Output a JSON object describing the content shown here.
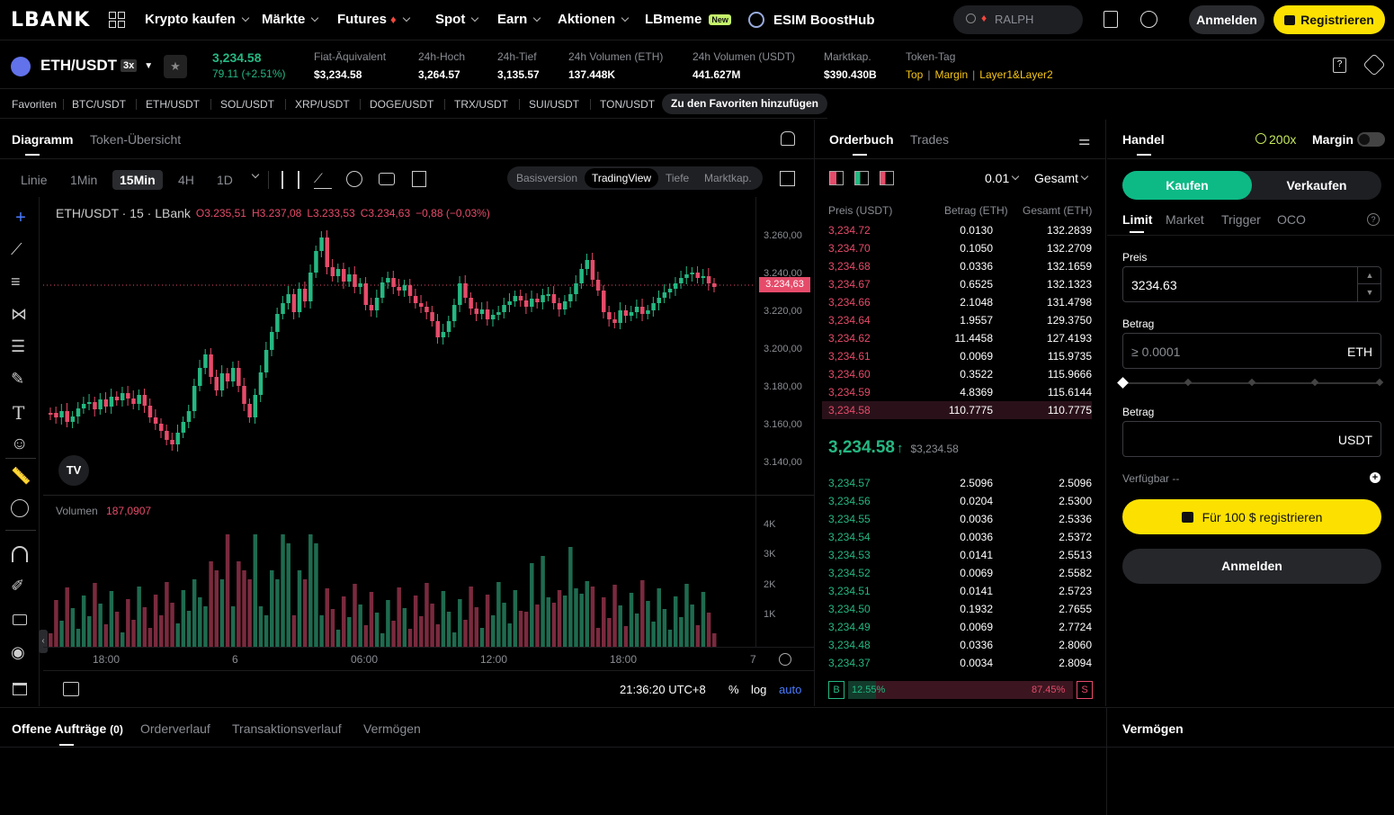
{
  "header": {
    "logo": "LBANK",
    "nav": [
      "Krypto kaufen",
      "Märkte",
      "Futures",
      "Spot",
      "Earn",
      "Aktionen",
      "LBmeme",
      "ESIM BoostHub"
    ],
    "new_badge": "New",
    "search_placeholder": "RALPH",
    "login": "Anmelden",
    "register": "Registrieren"
  },
  "ticker": {
    "pair": "ETH/USDT",
    "leverage": "3x",
    "price": "3,234.58",
    "change": "79.11 (+2.51%)",
    "stats": [
      {
        "label": "Fiat-Äquivalent",
        "value": "$3,234.58"
      },
      {
        "label": "24h-Hoch",
        "value": "3,264.57"
      },
      {
        "label": "24h-Tief",
        "value": "3,135.57"
      },
      {
        "label": "24h Volumen (ETH)",
        "value": "137.448K"
      },
      {
        "label": "24h Volumen (USDT)",
        "value": "441.627M"
      },
      {
        "label": "Marktkap.",
        "value": "$390.430B"
      }
    ],
    "tag_label": "Token-Tag",
    "tags": [
      "Top",
      "Margin",
      "Layer1&Layer2"
    ]
  },
  "favorites": {
    "label": "Favoriten",
    "pairs": [
      "BTC/USDT",
      "ETH/USDT",
      "SOL/USDT",
      "XRP/USDT",
      "DOGE/USDT",
      "TRX/USDT",
      "SUI/USDT",
      "TON/USDT"
    ],
    "add": "Zu den Favoriten hinzufügen"
  },
  "chart": {
    "tabs": [
      "Diagramm",
      "Token-Übersicht"
    ],
    "timeframes": [
      "Linie",
      "1Min",
      "15Min",
      "4H",
      "1D"
    ],
    "versions": [
      "Basisversion",
      "TradingView",
      "Tiefe",
      "Marktkap."
    ],
    "legend_pair": "ETH/USDT · 15 · LBank",
    "ohlc": {
      "o": "O3.235,51",
      "h": "H3.237,08",
      "l": "L3.233,53",
      "c": "C3.234,63",
      "chg": "−0,88 (−0,03%)"
    },
    "price_ticks": [
      "3.260,00",
      "3.240,00",
      "3.220,00",
      "3.200,00",
      "3.180,00",
      "3.160,00",
      "3.140,00"
    ],
    "last_price": "3.234,63",
    "volume_label": "Volumen",
    "volume_value": "187,0907",
    "volume_ticks": [
      "4K",
      "3K",
      "2K",
      "1K"
    ],
    "time_ticks": [
      "18:00",
      "6",
      "06:00",
      "12:00",
      "18:00",
      "7"
    ],
    "clock": "21:36:20 UTC+8",
    "pct": "%",
    "log": "log",
    "auto": "auto"
  },
  "orderbook": {
    "tabs": [
      "Orderbuch",
      "Trades"
    ],
    "precision": "0.01",
    "mode": "Gesamt",
    "headers": [
      "Preis (USDT)",
      "Betrag (ETH)",
      "Gesamt (ETH)"
    ],
    "asks": [
      [
        "3,234.72",
        "0.0130",
        "132.2839"
      ],
      [
        "3,234.70",
        "0.1050",
        "132.2709"
      ],
      [
        "3,234.68",
        "0.0336",
        "132.1659"
      ],
      [
        "3,234.67",
        "0.6525",
        "132.1323"
      ],
      [
        "3,234.66",
        "2.1048",
        "131.4798"
      ],
      [
        "3,234.64",
        "1.9557",
        "129.3750"
      ],
      [
        "3,234.62",
        "11.4458",
        "127.4193"
      ],
      [
        "3,234.61",
        "0.0069",
        "115.9735"
      ],
      [
        "3,234.60",
        "0.3522",
        "115.9666"
      ],
      [
        "3,234.59",
        "4.8369",
        "115.6144"
      ],
      [
        "3,234.58",
        "110.7775",
        "110.7775"
      ]
    ],
    "mid_price": "3,234.58",
    "mid_fiat": "$3,234.58",
    "bids": [
      [
        "3,234.57",
        "2.5096",
        "2.5096"
      ],
      [
        "3,234.56",
        "0.0204",
        "2.5300"
      ],
      [
        "3,234.55",
        "0.0036",
        "2.5336"
      ],
      [
        "3,234.54",
        "0.0036",
        "2.5372"
      ],
      [
        "3,234.53",
        "0.0141",
        "2.5513"
      ],
      [
        "3,234.52",
        "0.0069",
        "2.5582"
      ],
      [
        "3,234.51",
        "0.0141",
        "2.5723"
      ],
      [
        "3,234.50",
        "0.1932",
        "2.7655"
      ],
      [
        "3,234.49",
        "0.0069",
        "2.7724"
      ],
      [
        "3,234.48",
        "0.0336",
        "2.8060"
      ],
      [
        "3,234.37",
        "0.0034",
        "2.8094"
      ]
    ],
    "buy_label": "B",
    "buy_pct": "12.55%",
    "sell_pct": "87.45%",
    "sell_label": "S",
    "buy_ratio": 0.1255
  },
  "trade": {
    "title": "Handel",
    "leverage": "200x",
    "margin": "Margin",
    "buy": "Kaufen",
    "sell": "Verkaufen",
    "types": [
      "Limit",
      "Market",
      "Trigger",
      "OCO"
    ],
    "price_label": "Preis",
    "price_value": "3234.63",
    "amount_label": "Betrag",
    "amount_placeholder": "≥ 0.0001",
    "amount_unit": "ETH",
    "amount2_label": "Betrag",
    "amount2_unit": "USDT",
    "available": "Verfügbar --",
    "promo": "Für 100 $ registrieren",
    "login": "Anmelden"
  },
  "bottom": {
    "tabs": [
      "Offene Aufträge",
      "Orderverlauf",
      "Transaktionsverlauf",
      "Vermögen"
    ],
    "open_count": "(0)",
    "assets": "Vermögen"
  },
  "colors": {
    "up": "#25b882",
    "down": "#e64b6a",
    "accent": "#fce100"
  }
}
